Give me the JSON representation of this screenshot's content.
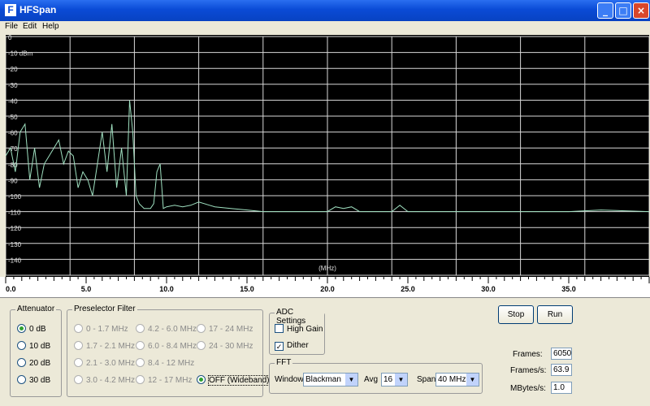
{
  "window": {
    "title": "HFSpan",
    "app_icon": "F",
    "min": "_",
    "max": "□",
    "close": "×"
  },
  "menu": [
    "File",
    "Edit",
    "Help"
  ],
  "plot": {
    "y_labels": [
      "0",
      "-10 dBm",
      "-20",
      "-30",
      "-40",
      "-50",
      "-60",
      "-70",
      "-80",
      "-90",
      "-100",
      "-110",
      "-120",
      "-130",
      "-140"
    ],
    "unit_label": "(MHz)",
    "trace_color": "#9fe0c0",
    "grid_color": "#d8d8d8"
  },
  "ruler": {
    "labels": [
      "0.0",
      "5.0",
      "10.0",
      "15.0",
      "20.0",
      "25.0",
      "30.0",
      "35.0"
    ]
  },
  "attenuator": {
    "title": "Attenuator",
    "options": [
      "0 dB",
      "10 dB",
      "20 dB",
      "30 dB"
    ],
    "selected": 0
  },
  "preselector": {
    "title": "Preselector Filter",
    "options": [
      "0 - 1.7 MHz",
      "1.7 - 2.1 MHz",
      "2.1 - 3.0 MHz",
      "3.0 - 4.2 MHz",
      "4.2 - 6.0 MHz",
      "6.0 - 8.4 MHz",
      "8.4 - 12 MHz",
      "12 - 17 MHz",
      "17 - 24 MHz",
      "24 - 30 MHz",
      "OFF (Wideband)"
    ]
  },
  "adc": {
    "title": "ADC Settings",
    "high_gain": "High Gain",
    "dither": "Dither",
    "dither_checked": "✓"
  },
  "fft": {
    "title": "FFT",
    "window_label": "Window",
    "window_value": "Blackman",
    "avg_label": "Avg",
    "avg_value": "16",
    "span_label": "Span",
    "span_value": "40 MHz",
    "arrow": "▼"
  },
  "buttons": {
    "stop": "Stop",
    "run": "Run"
  },
  "stats": {
    "frames_label": "Frames:",
    "frames_value": "6050",
    "fps_label": "Frames/s:",
    "fps_value": "63.9",
    "mbps_label": "MBytes/s:",
    "mbps_value": "1.0"
  },
  "chart_data": {
    "type": "line",
    "xlabel": "(MHz)",
    "ylabel": "dBm",
    "xlim": [
      0,
      40
    ],
    "ylim": [
      -150,
      0
    ],
    "grid": true,
    "series": [
      {
        "x": [
          0,
          0.3,
          0.6,
          0.9,
          1.2,
          1.5,
          1.8,
          2.1,
          2.4,
          2.7,
          3.0,
          3.3,
          3.6,
          3.9,
          4.2,
          4.5,
          4.8,
          5.1,
          5.4,
          5.7,
          6.0,
          6.3,
          6.6,
          6.9,
          7.2,
          7.5,
          7.7,
          7.9,
          8.1,
          8.3,
          8.6,
          9.0,
          9.2,
          9.4,
          9.6,
          9.8,
          10.0,
          10.5,
          11,
          11.5,
          12,
          13,
          14,
          15,
          16,
          18,
          20,
          20.5,
          21,
          21.5,
          22,
          24,
          24.5,
          25,
          27,
          30,
          33,
          35,
          37,
          40
        ],
        "y": [
          -75,
          -70,
          -85,
          -60,
          -55,
          -90,
          -70,
          -95,
          -80,
          -75,
          -70,
          -65,
          -80,
          -72,
          -75,
          -95,
          -85,
          -90,
          -100,
          -80,
          -60,
          -85,
          -55,
          -95,
          -70,
          -100,
          -40,
          -60,
          -100,
          -105,
          -108,
          -108,
          -105,
          -85,
          -80,
          -108,
          -107,
          -106,
          -107,
          -106,
          -104,
          -107,
          -108,
          -109,
          -110,
          -110,
          -110,
          -107,
          -108,
          -107,
          -110,
          -110,
          -106,
          -110,
          -110,
          -110,
          -110,
          -110,
          -109,
          -110
        ]
      }
    ]
  }
}
